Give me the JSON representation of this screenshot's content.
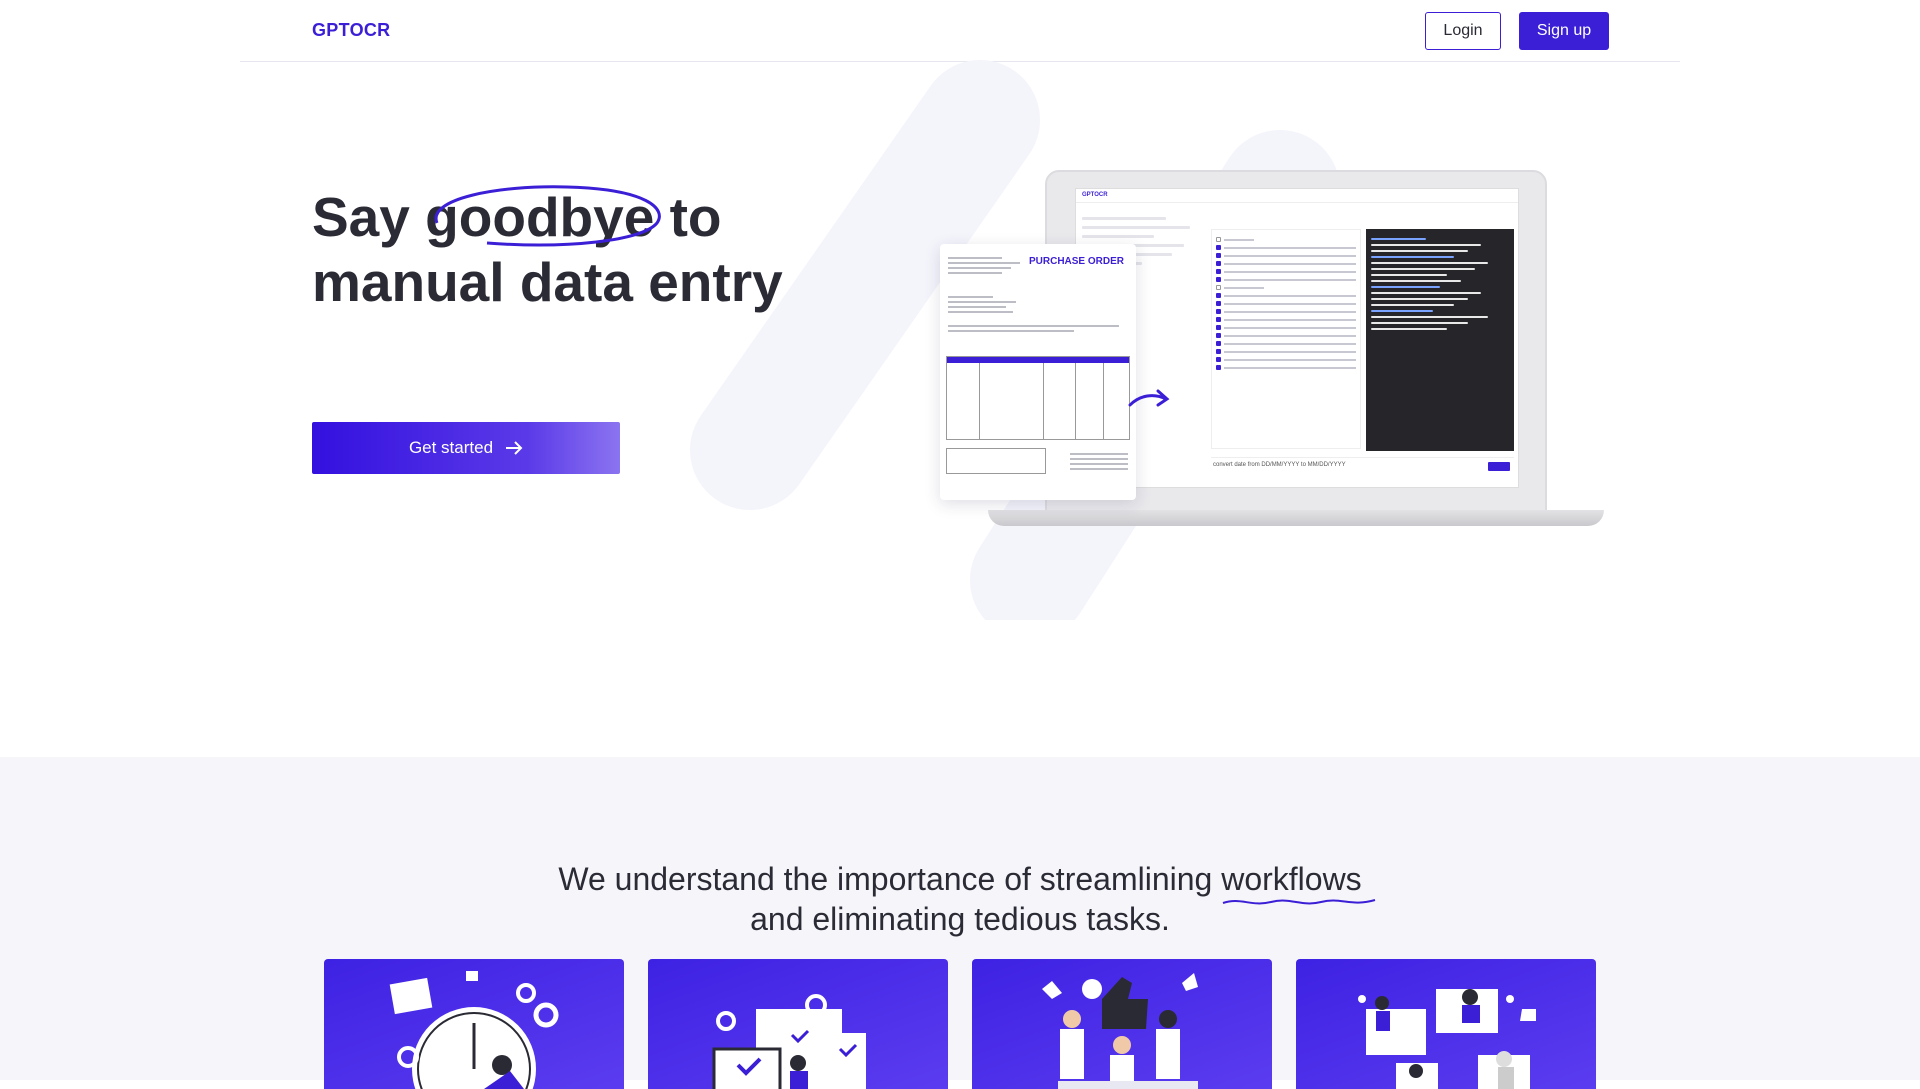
{
  "header": {
    "logo": "GPTOCR",
    "login_label": "Login",
    "signup_label": "Sign up"
  },
  "hero": {
    "title_part1": "Say ",
    "title_highlight": "goodbye",
    "title_part2": " to manual data entry",
    "cta_label": "Get started",
    "cta_icon": "arrow-right-icon"
  },
  "mockup": {
    "app_name": "GPTOCR",
    "document_title": "PURCHASE ORDER",
    "query_text": "convert date from DD/MM/YYYY to MM/DD/YYYY"
  },
  "section": {
    "tagline_part1": "We understand the importance of streamlining ",
    "tagline_highlight": "workflows",
    "tagline_part2": "and eliminating tedious tasks."
  },
  "cards": [
    {
      "illustration": "clock-person-illustration"
    },
    {
      "illustration": "devices-checkmarks-illustration"
    },
    {
      "illustration": "team-thumbs-up-illustration"
    },
    {
      "illustration": "remote-team-illustration"
    }
  ],
  "colors": {
    "brand": "#3b1fd6",
    "section_bg": "#f5f5fa",
    "text": "#2b2b36"
  }
}
